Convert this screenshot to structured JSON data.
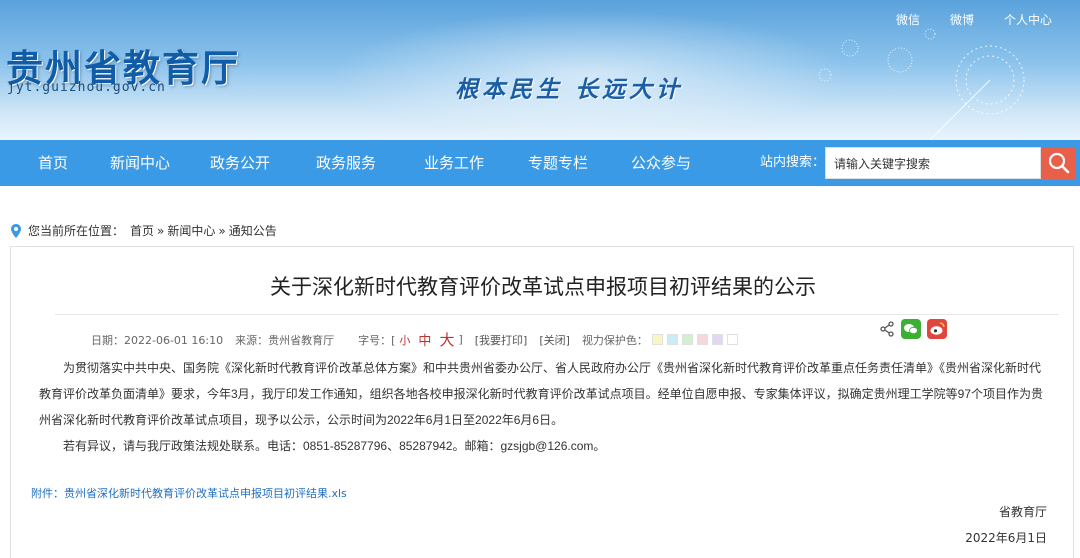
{
  "header": {
    "site_title": "贵州省教育厅",
    "site_domain": "jyt.guizhou.gov.cn",
    "slogan": "根本民生 长远大计",
    "top_links": [
      "微信",
      "微博",
      "个人中心"
    ]
  },
  "nav": {
    "items": [
      "首页",
      "新闻中心",
      "政务公开",
      "政务服务",
      "业务工作",
      "专题专栏",
      "公众参与"
    ],
    "search_label": "站内搜索：",
    "search_placeholder": "请输入关键字搜索"
  },
  "breadcrumb": {
    "prefix": "您当前所在位置：",
    "items": [
      "首页",
      "新闻中心",
      "通知公告"
    ],
    "separator": "»"
  },
  "article": {
    "title": "关于深化新时代教育评价改革试点申报项目初评结果的公示",
    "meta": {
      "date": "日期：2022-06-01 16:10",
      "source": "来源：贵州省教育厅",
      "font_size_label": "字号：[",
      "font_small": "小",
      "font_mid": "中",
      "font_big": "大",
      "font_size_close": "]",
      "print": "[我要打印]",
      "close": "[关闭]",
      "eye_care_label": "视力保护色：",
      "eye_care_colors": [
        "#fbf5c4",
        "#c9ecf7",
        "#d2efd3",
        "#f6d8dc",
        "#e2d6f2",
        "#ffffff"
      ]
    },
    "paragraphs": [
      "为贯彻落实中共中央、国务院《深化新时代教育评价改革总体方案》和中共贵州省委办公厅、省人民政府办公厅《贵州省深化新时代教育评价改革重点任务责任清单》《贵州省深化新时代教育评价改革负面清单》要求，今年3月，我厅印发工作通知，组织各地各校申报深化新时代教育评价改革试点项目。经单位自愿申报、专家集体评议，拟确定贵州理工学院等97个项目作为贵州省深化新时代教育评价改革试点项目，现予以公示，公示时间为2022年6月1日至2022年6月6日。",
      "若有异议，请与我厅政策法规处联系。电话：0851-85287796、85287942。邮箱：gzsjgb@126.com。"
    ],
    "attachment": "附件：贵州省深化新时代教育评价改革试点申报项目初评结果.xls",
    "signature_org": "省教育厅",
    "signature_date": "2022年6月1日"
  },
  "colors": {
    "nav_bg": "#3a9ae6",
    "search_button": "#e8604a",
    "title_blue": "#0f5ca8",
    "wechat": "#3cb034",
    "weibo": "#e0463c"
  }
}
